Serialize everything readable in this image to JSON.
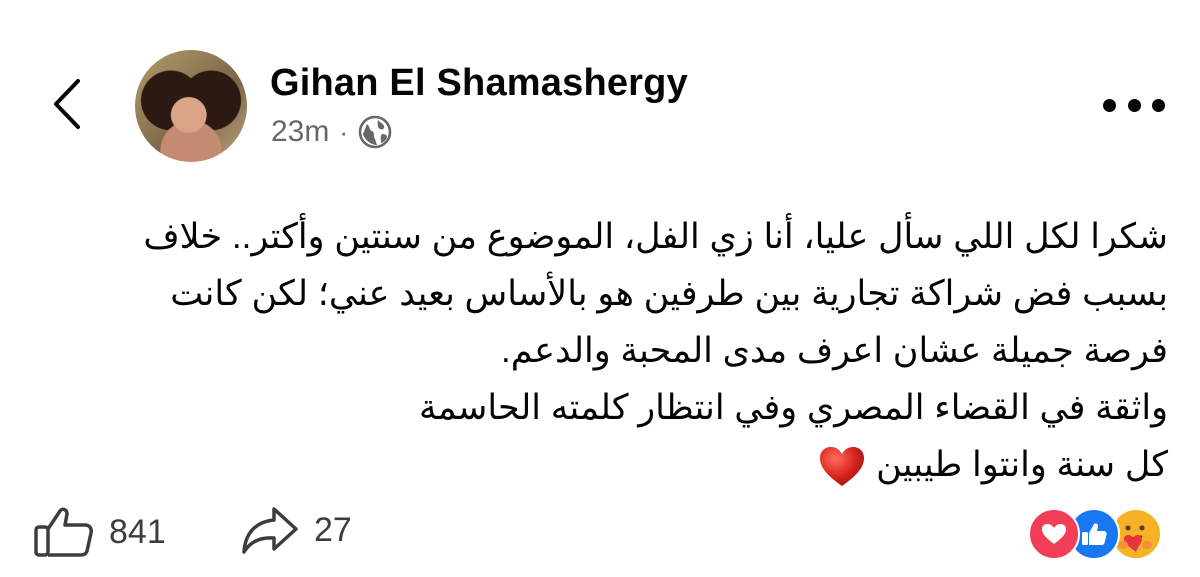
{
  "post": {
    "author_name": "Gihan El Shamashergy",
    "time": "23m",
    "separator": "·",
    "privacy_icon": "globe-icon",
    "body_lines": [
      "شكرا لكل اللي سأل عليا، أنا زي الفل، الموضوع من سنتين وأكتر.. خلاف",
      "بسبب فض شراكة تجارية بين طرفين هو بالأساس بعيد عني؛ لكن كانت",
      "فرصة جميلة عشان اعرف مدى المحبة والدعم.",
      "واثقة في القضاء المصري وفي انتظار كلمته الحاسمة",
      "كل سنة وانتوا طيبين"
    ],
    "closing_emoji": "red-heart"
  },
  "actions": {
    "like_count": "841",
    "share_count": "27"
  },
  "reactions": [
    "love-reaction-icon",
    "like-reaction-icon",
    "care-reaction-icon"
  ],
  "colors": {
    "text": "#050505",
    "secondary": "#65676b",
    "love": "#f33e58",
    "like": "#1877f2",
    "care": "#f7b125"
  }
}
